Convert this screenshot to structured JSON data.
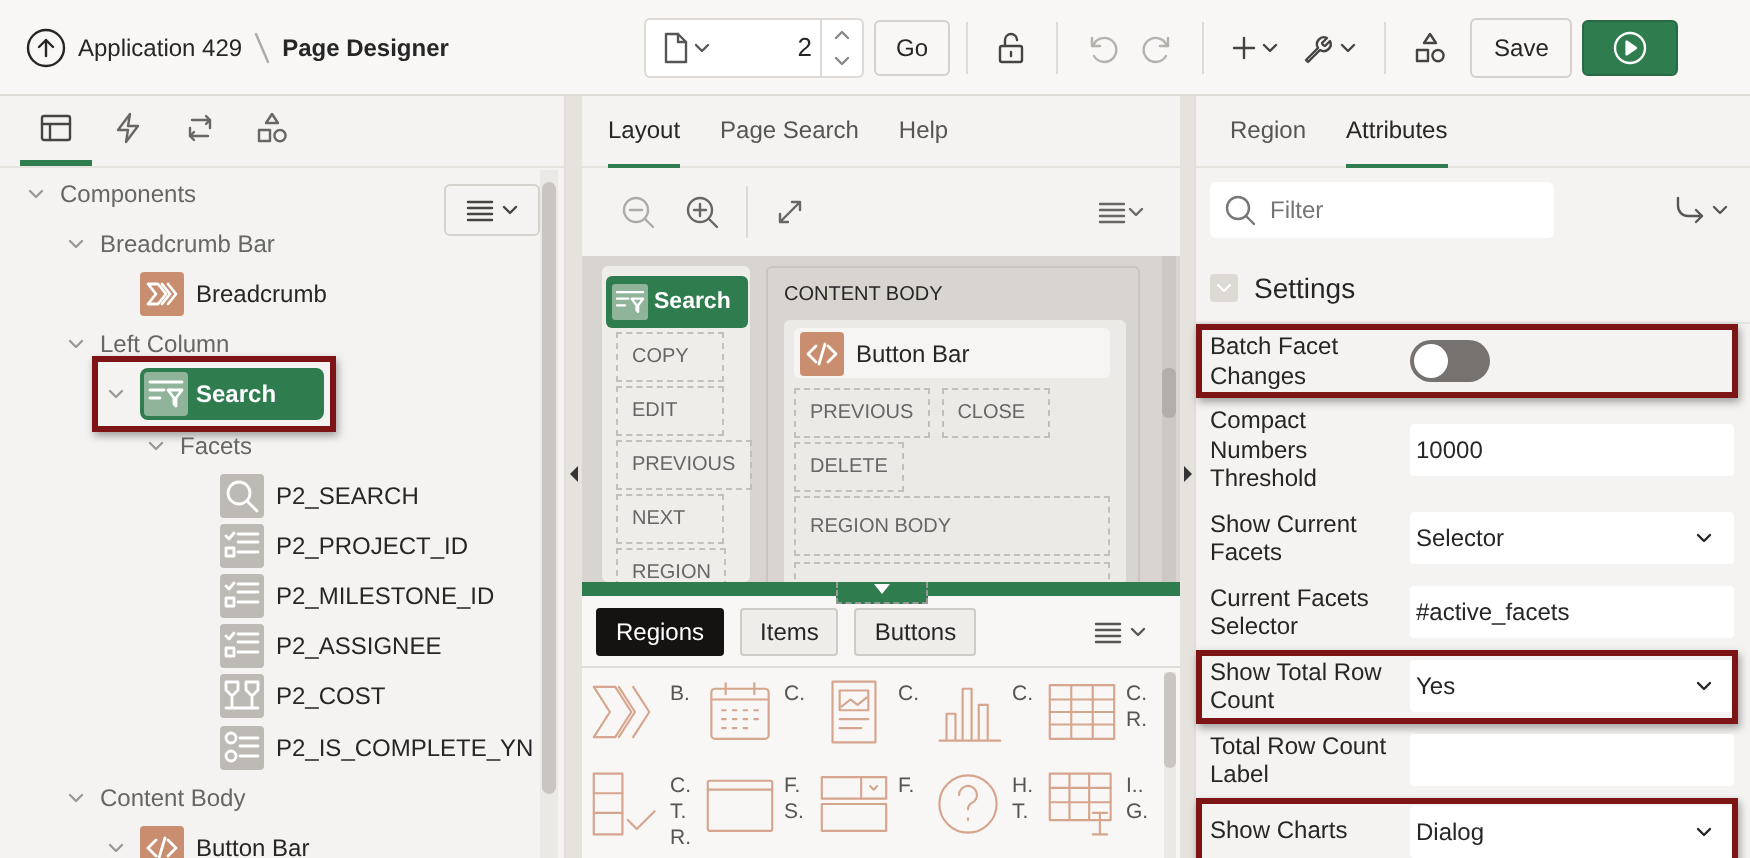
{
  "header": {
    "app": "Application 429",
    "title": "Page Designer",
    "page": "2",
    "go": "Go",
    "save": "Save",
    "tools": [
      {
        "kind": "lock",
        "disabled": false,
        "menu": false
      },
      {
        "kind": "undo",
        "disabled": true,
        "menu": false
      },
      {
        "kind": "redo",
        "disabled": true,
        "menu": false
      },
      {
        "kind": "plus",
        "disabled": false,
        "menu": true
      },
      {
        "kind": "wrench",
        "disabled": false,
        "menu": true
      },
      {
        "kind": "shapes",
        "disabled": false,
        "menu": false
      }
    ]
  },
  "left": {
    "tabs": [
      {
        "kind": "grid",
        "selected": true
      },
      {
        "kind": "bolt",
        "selected": false
      },
      {
        "kind": "loop",
        "selected": false
      },
      {
        "kind": "shapes",
        "selected": false
      }
    ],
    "tree": [
      {
        "label": "Components",
        "kind": "group",
        "expanded": true,
        "selected": false,
        "highlighted": false,
        "children": [
          {
            "label": "Breadcrumb Bar",
            "kind": "group",
            "expanded": true,
            "selected": false,
            "highlighted": false,
            "children": [
              {
                "label": "Breadcrumb",
                "kind": "breadcrumb",
                "selected": false,
                "highlighted": false
              }
            ]
          },
          {
            "label": "Left Column",
            "kind": "group",
            "expanded": true,
            "selected": false,
            "highlighted": false,
            "children": [
              {
                "label": "Search",
                "kind": "search-region",
                "expanded": true,
                "selected": true,
                "highlighted": true,
                "children": [
                  {
                    "label": "Facets",
                    "kind": "group",
                    "expanded": true,
                    "selected": false,
                    "highlighted": false,
                    "children": [
                      {
                        "label": "P2_SEARCH",
                        "kind": "search",
                        "selected": false,
                        "highlighted": false
                      },
                      {
                        "label": "P2_PROJECT_ID",
                        "kind": "checkbox",
                        "selected": false,
                        "highlighted": false
                      },
                      {
                        "label": "P2_MILESTONE_ID",
                        "kind": "checkbox",
                        "selected": false,
                        "highlighted": false
                      },
                      {
                        "label": "P2_ASSIGNEE",
                        "kind": "checkbox",
                        "selected": false,
                        "highlighted": false
                      },
                      {
                        "label": "P2_COST",
                        "kind": "range",
                        "selected": false,
                        "highlighted": false
                      },
                      {
                        "label": "P2_IS_COMPLETE_YN",
                        "kind": "radio",
                        "selected": false,
                        "highlighted": false
                      }
                    ]
                  }
                ]
              }
            ]
          },
          {
            "label": "Content Body",
            "kind": "group",
            "expanded": true,
            "selected": false,
            "highlighted": false,
            "children": [
              {
                "label": "Button Bar",
                "kind": "code",
                "expanded": true,
                "selected": false,
                "highlighted": false
              }
            ]
          }
        ]
      }
    ]
  },
  "middle": {
    "tabs": [
      {
        "label": "Layout",
        "selected": true
      },
      {
        "label": "Page Search",
        "selected": false
      },
      {
        "label": "Help",
        "selected": false
      }
    ],
    "canvas": {
      "left_region": {
        "title": "Search",
        "buttons": [
          "COPY",
          "EDIT",
          "PREVIOUS",
          "NEXT",
          "REGION"
        ]
      },
      "body": {
        "title": "CONTENT BODY",
        "region": {
          "title": "Button Bar",
          "buttons": [
            "PREVIOUS",
            "CLOSE",
            "DELETE"
          ],
          "body": "REGION BODY"
        }
      }
    },
    "gallery": {
      "tabs": [
        {
          "label": "Regions",
          "selected": true
        },
        {
          "label": "Items",
          "selected": false
        },
        {
          "label": "Buttons",
          "selected": false
        }
      ],
      "items": [
        {
          "kind": "breadcrumb",
          "label": "B."
        },
        {
          "kind": "calendar",
          "label": "C."
        },
        {
          "kind": "card",
          "label": "C."
        },
        {
          "kind": "chart",
          "label": "C."
        },
        {
          "kind": "table",
          "label": "C. R."
        },
        {
          "kind": "checklist",
          "label": "C. T. R."
        },
        {
          "kind": "window",
          "label": "F. S."
        },
        {
          "kind": "form",
          "label": "F."
        },
        {
          "kind": "help",
          "label": "H. T."
        },
        {
          "kind": "grid",
          "label": "I.. G."
        }
      ]
    }
  },
  "right": {
    "tabs": [
      {
        "label": "Region",
        "selected": false
      },
      {
        "label": "Attributes",
        "selected": true
      }
    ],
    "filter": {
      "placeholder": "Filter"
    },
    "section": {
      "title": "Settings",
      "expanded": true
    },
    "properties": [
      {
        "label": "Batch Facet Changes",
        "kind": "switch",
        "on": false,
        "highlighted": true
      },
      {
        "label": "Compact Numbers Threshold",
        "kind": "text",
        "value": "10000",
        "highlighted": false
      },
      {
        "label": "Show Current Facets",
        "kind": "select",
        "value": "Selector",
        "highlighted": false
      },
      {
        "label": "Current Facets Selector",
        "kind": "text",
        "value": "#active_facets",
        "highlighted": false
      },
      {
        "label": "Show Total Row Count",
        "kind": "select",
        "value": "Yes",
        "highlighted": true
      },
      {
        "label": "Total Row Count Label",
        "kind": "text",
        "highlighted": false
      },
      {
        "label": "Show Charts",
        "kind": "select",
        "value": "Dialog",
        "highlighted": true
      }
    ]
  }
}
